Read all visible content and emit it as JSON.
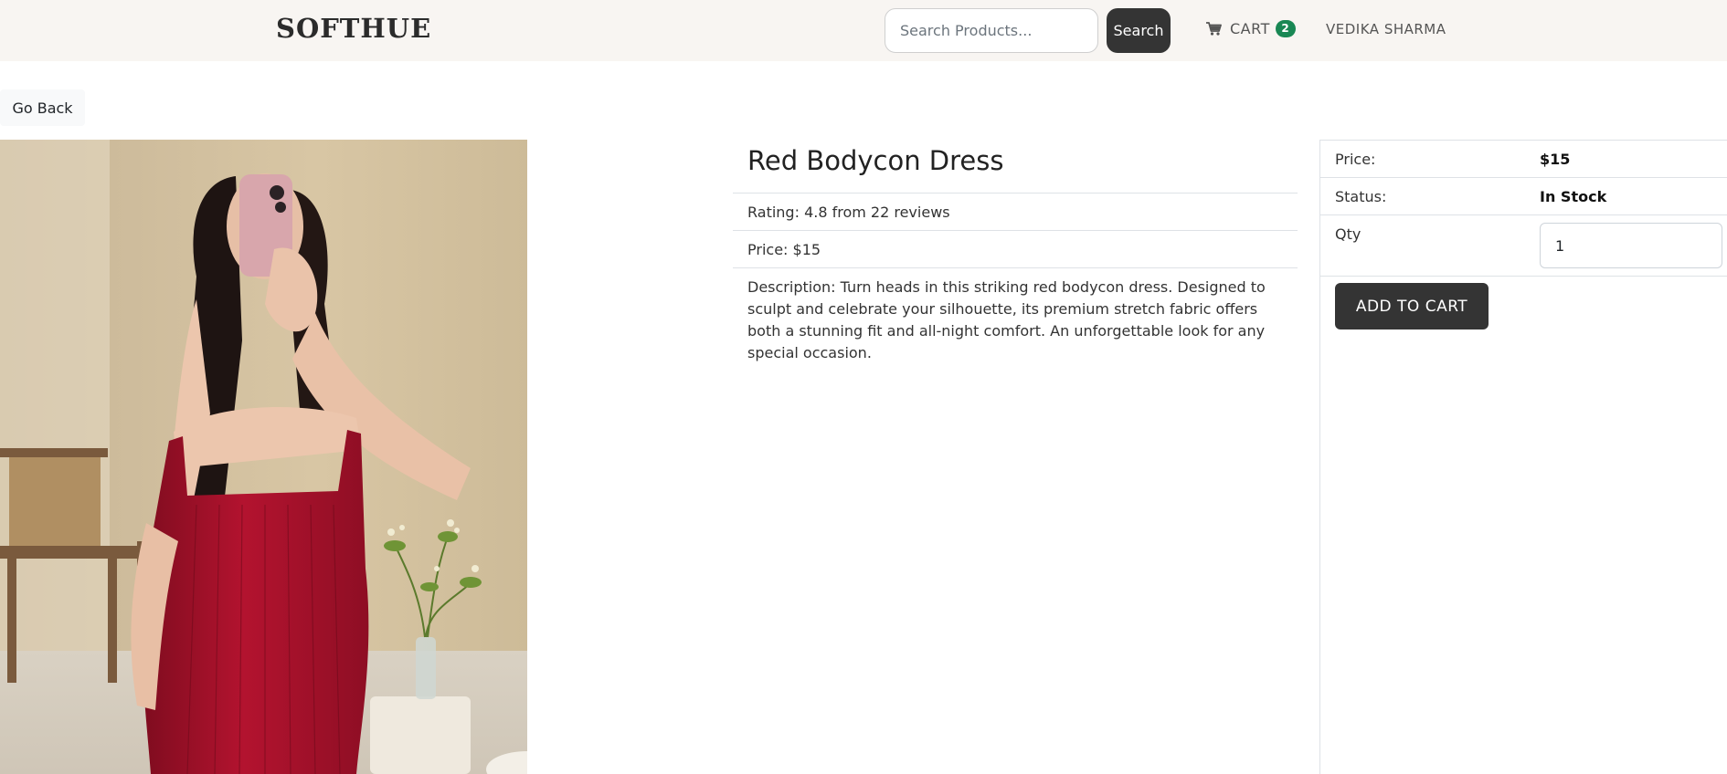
{
  "navbar": {
    "brand": "SOFTHUE",
    "search_placeholder": "Search Products...",
    "search_label": "Search",
    "cart_label": "CART",
    "cart_count": "2",
    "user_name": "VEDIKA SHARMA",
    "cart_icon": "shopping-cart-icon",
    "badge_color": "#198754"
  },
  "go_back_label": "Go Back",
  "product": {
    "image_alt": "red bodycon dress photo",
    "title": "Red Bodycon Dress",
    "rating_text": "Rating: 4.8 from 22 reviews",
    "price_text": "Price: $15",
    "description": "Description: Turn heads in this striking red bodycon dress. Designed to sculpt and celebrate your silhouette, its premium stretch fabric offers both a stunning fit and all-night comfort. An unforgettable look for any special occasion."
  },
  "purchase": {
    "price_label": "Price:",
    "price_value": "$15",
    "status_label": "Status:",
    "status_value": "In Stock",
    "qty_label": "Qty",
    "qty_value": "1",
    "add_to_cart_label": "ADD TO CART"
  },
  "colors": {
    "navbar_bg": "#f8f5f2",
    "button_dark": "#343434",
    "dress_red": "#a5112b"
  }
}
